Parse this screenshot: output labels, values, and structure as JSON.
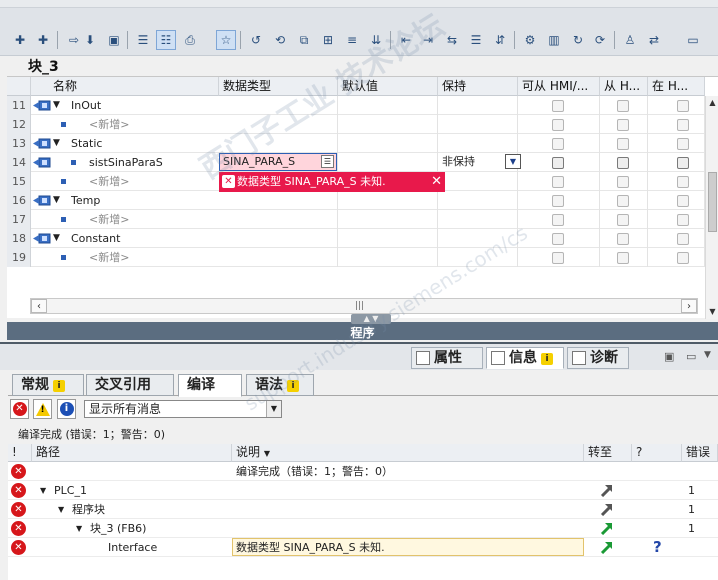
{
  "block": {
    "title": "块_3"
  },
  "table": {
    "headers": {
      "name": "名称",
      "datatype": "数据类型",
      "default": "默认值",
      "retain": "保持",
      "hmi_access": "可从 HMI/...",
      "hmi_write": "从 H...",
      "hmi_visible": "在 H..."
    },
    "rows": [
      {
        "num": "11",
        "kind": "section",
        "name": "InOut"
      },
      {
        "num": "12",
        "kind": "add",
        "name": "<新增>"
      },
      {
        "num": "13",
        "kind": "section",
        "name": "Static"
      },
      {
        "num": "14",
        "kind": "var",
        "name": "sistSinaParaS",
        "datatype": "SINA_PARA_S",
        "retain": "非保持"
      },
      {
        "num": "15",
        "kind": "add",
        "name": "<新增>"
      },
      {
        "num": "16",
        "kind": "section",
        "name": "Temp"
      },
      {
        "num": "17",
        "kind": "add",
        "name": "<新增>"
      },
      {
        "num": "18",
        "kind": "section",
        "name": "Constant"
      },
      {
        "num": "19",
        "kind": "add",
        "name": "<新增>"
      }
    ],
    "error_popup": "数据类型 SINA_PARA_S 未知.",
    "close_glyph": "✕"
  },
  "section_label": "程序",
  "inspector": {
    "tabs": [
      "属性",
      "信息",
      "诊断"
    ],
    "info_badge": "i",
    "sub_tabs": [
      "常规",
      "交叉引用",
      "编译",
      "语法"
    ],
    "filter": {
      "value": "显示所有消息"
    },
    "summary": "编译完成 (错误：1；警告：0)",
    "columns": {
      "bang": "!",
      "path": "路径",
      "desc": "说明",
      "goto": "转至",
      "q": "?",
      "errors": "错误"
    },
    "messages": [
      {
        "path": "",
        "indent": 0,
        "desc": "编译完成（错误：1；警告：0）",
        "goto": false,
        "q": false,
        "count": ""
      },
      {
        "path": "PLC_1",
        "indent": 1,
        "desc": "",
        "goto": true,
        "goto_color": "#555555",
        "q": false,
        "count": "1"
      },
      {
        "path": "程序块",
        "indent": 2,
        "desc": "",
        "goto": true,
        "goto_color": "#555555",
        "q": false,
        "count": "1"
      },
      {
        "path": "块_3 (FB6)",
        "indent": 3,
        "desc": "",
        "goto": true,
        "goto_color": "#1a9a35",
        "q": false,
        "count": "1"
      },
      {
        "path": "Interface",
        "indent": 4,
        "desc": "数据类型 SINA_PARA_S 未知.",
        "goto": true,
        "goto_color": "#1a9a35",
        "q": true,
        "count": ""
      }
    ]
  },
  "watermark": {
    "line1": "西门子工业  技术论坛",
    "line2": "support.industry.siemens.com/cs"
  },
  "colors": {
    "error": "#d6171b",
    "error_popup_bg": "#e8194b",
    "accent": "#2d5fb4",
    "section_bar": "#5b6d80"
  }
}
